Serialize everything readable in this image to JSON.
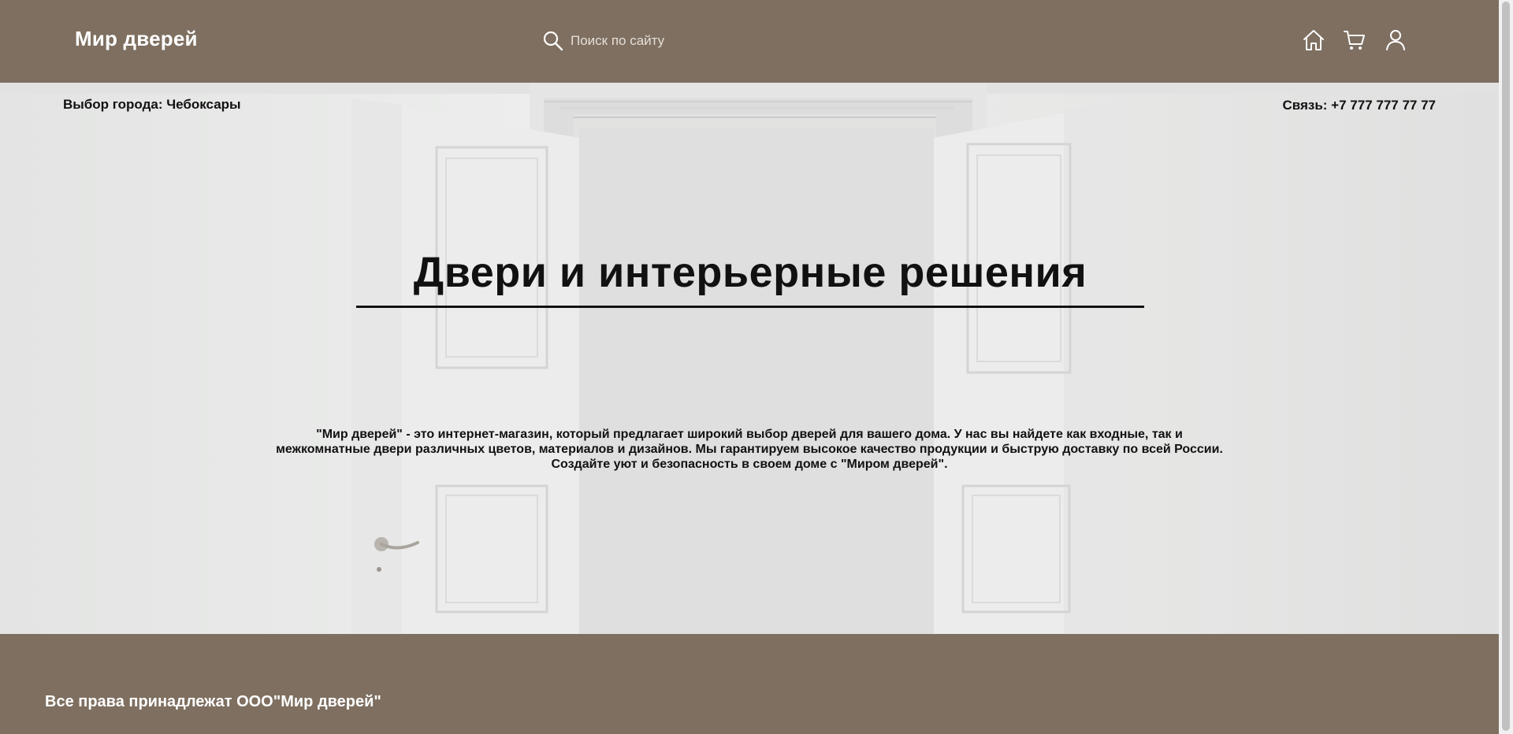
{
  "header": {
    "logo": "Мир дверей",
    "search": {
      "placeholder": "Поиск по сайту",
      "icon": "search-icon"
    },
    "icons": [
      "home-icon",
      "cart-icon",
      "user-icon"
    ]
  },
  "info_bar": {
    "city": "Выбор города: Чебоксары",
    "contact": "Связь: +7 777 777 77 77"
  },
  "hero": {
    "title": "Двери и интерьерные решения",
    "description": "\"Мир дверей\" - это интернет-магазин, который предлагает широкий выбор дверей для вашего дома. У нас вы найдете как входные, так и межкомнатные двери различных цветов, материалов и дизайнов. Мы гарантируем высокое качество продукции и быструю доставку по всей России. Создайте уют и безопасность в своем доме с \"Миром дверей\"."
  },
  "footer": {
    "copyright": "Все права принадлежат ООО\"Мир дверей\""
  },
  "colors": {
    "brand": "#7e6f60",
    "text": "#111111",
    "header_text": "#ffffff"
  }
}
